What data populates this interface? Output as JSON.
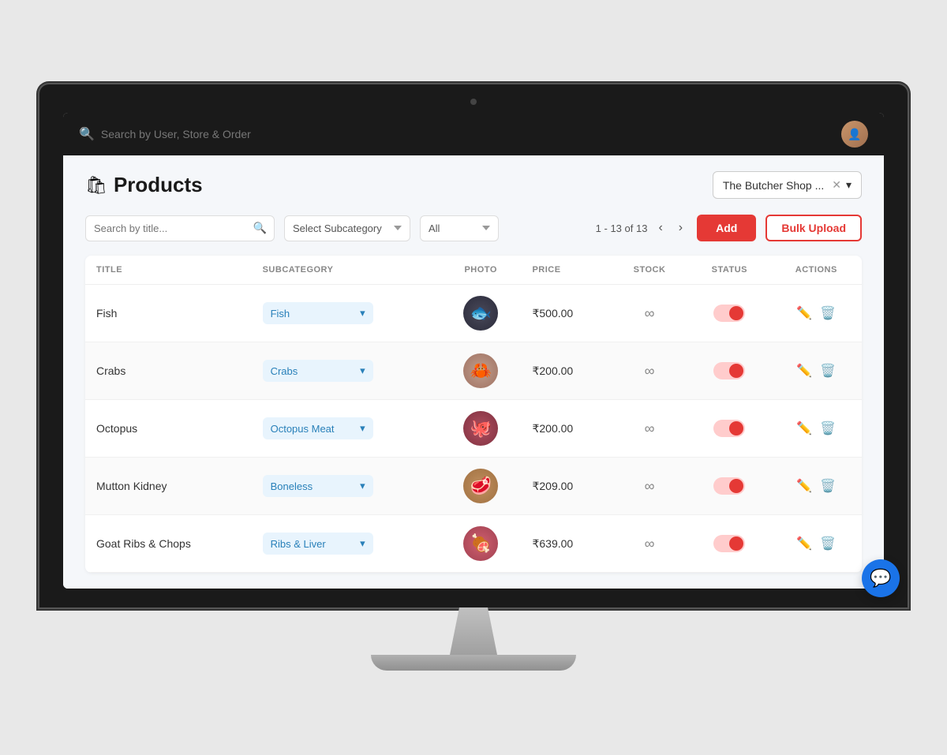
{
  "topbar": {
    "search_placeholder": "Search by User, Store & Order"
  },
  "page": {
    "title": "Products",
    "shop_name": "The Butcher Shop ...",
    "pagination": "1 - 13 of 13"
  },
  "filters": {
    "search_placeholder": "Search by title...",
    "subcategory_label": "Select Subcategory",
    "status_label": "All"
  },
  "buttons": {
    "add": "Add",
    "bulk_upload": "Bulk Upload"
  },
  "table": {
    "headers": [
      "TITLE",
      "SUBCATEGORY",
      "PHOTO",
      "PRICE",
      "STOCK",
      "STATUS",
      "ACTIONS"
    ],
    "rows": [
      {
        "title": "Fish",
        "subcategory": "Fish",
        "price": "₹500.00",
        "stock": "∞",
        "status_active": true,
        "photo_class": "photo-fish"
      },
      {
        "title": "Crabs",
        "subcategory": "Crabs",
        "price": "₹200.00",
        "stock": "∞",
        "status_active": true,
        "photo_class": "photo-crab"
      },
      {
        "title": "Octopus",
        "subcategory": "Octopus Meat",
        "price": "₹200.00",
        "stock": "∞",
        "status_active": true,
        "photo_class": "photo-octopus"
      },
      {
        "title": "Mutton Kidney",
        "subcategory": "Boneless",
        "price": "₹209.00",
        "stock": "∞",
        "status_active": true,
        "photo_class": "photo-kidney"
      },
      {
        "title": "Goat Ribs & Chops",
        "subcategory": "Ribs & Liver",
        "price": "₹639.00",
        "stock": "∞",
        "status_active": true,
        "photo_class": "photo-ribs"
      }
    ]
  }
}
